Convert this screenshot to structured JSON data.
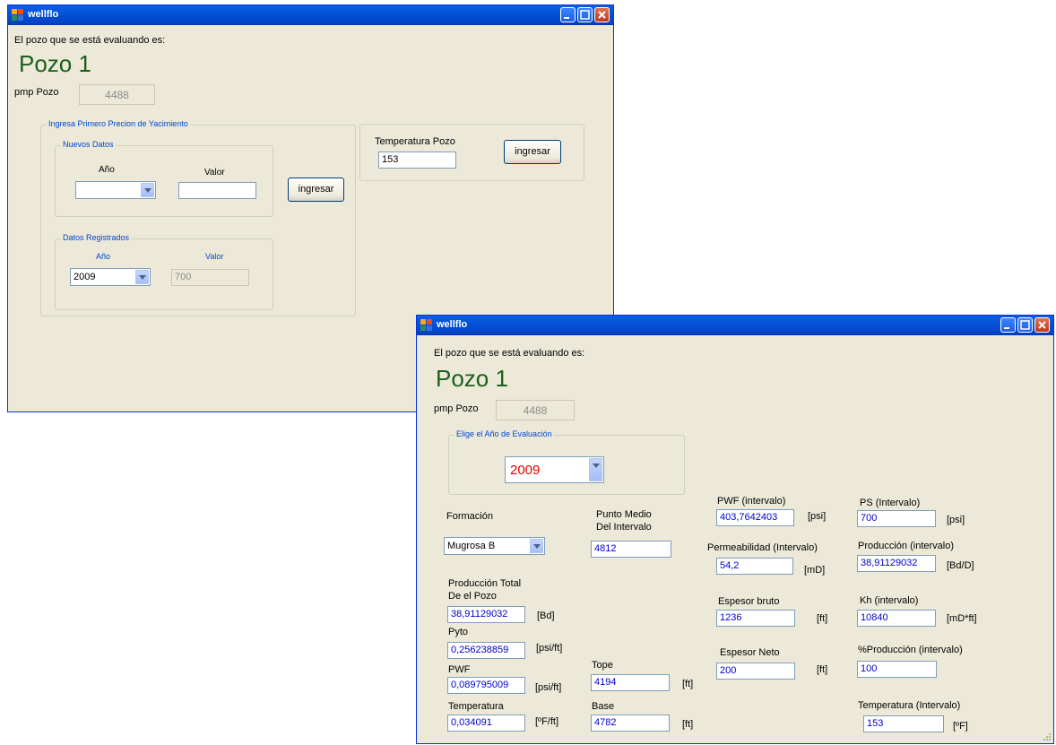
{
  "w1": {
    "title": "wellflo",
    "heading": "El pozo que se está evaluando es:",
    "pozo": "Pozo 1",
    "pmp_label": "pmp Pozo",
    "pmp_value": "4488",
    "grp_outer": "Ingresa Primero Precion de Yacimiento",
    "grp_nuevos": "Nuevos Datos",
    "anio_label": "Año",
    "valor_label": "Valor",
    "ingresar_left": "ingresar",
    "grp_registrados": "Datos Registrados",
    "anio2_label": "Año",
    "valor2_label": "Valor",
    "reg_year": "2009",
    "reg_value": "700",
    "temp_label": "Temperatura Pozo",
    "temp_value": "153",
    "ingresar_right": "ingresar"
  },
  "w2": {
    "title": "wellflo",
    "heading": "El pozo que se está evaluando es:",
    "pozo": "Pozo 1",
    "pmp_label": "pmp Pozo",
    "pmp_value": "4488",
    "grp_year": "Elige el Año de Evaluación",
    "year": "2009",
    "formacion_label": "Formación",
    "formacion_value": "Mugrosa B",
    "punto_medio_l1": "Punto Medio",
    "punto_medio_l2": "Del Intervalo",
    "punto_medio_value": "4812",
    "prod_total_l1": "Producción Total",
    "prod_total_l2": "De el Pozo",
    "prod_total_value": "38,91129032",
    "prod_total_unit": "[Bd]",
    "pyto_label": "Pyto",
    "pyto_value": "0,256238859",
    "pyto_unit": "[psi/ft]",
    "pwf_label": "PWF",
    "pwf_value": "0,089795009",
    "pwf_unit": "[psi/ft]",
    "temperatura_label": "Temperatura",
    "temperatura_value": "0,034091",
    "temperatura_unit": "[ºF/ft]",
    "tope_label": "Tope",
    "tope_value": "4194",
    "tope_unit": "[ft]",
    "base_label": "Base",
    "base_value": "4782",
    "base_unit": "[ft]",
    "pwf_int_label": "PWF (intervalo)",
    "pwf_int_value": "403,7642403",
    "pwf_int_unit": "[psi]",
    "perm_label": "Permeabilidad (Intervalo)",
    "perm_value": "54,2",
    "perm_unit": "[mD]",
    "esp_bruto_label": "Espesor bruto",
    "esp_bruto_value": "1236",
    "esp_bruto_unit": "[ft]",
    "esp_neto_label": "Espesor Neto",
    "esp_neto_value": "200",
    "esp_neto_unit": "[ft]",
    "ps_label": "PS (Intervalo)",
    "ps_value": "700",
    "ps_unit": "[psi]",
    "prod_int_label": "Producción (intervalo)",
    "prod_int_value": "38,91129032",
    "prod_int_unit": "[Bd/D]",
    "kh_label": "Kh (intervalo)",
    "kh_value": "10840",
    "kh_unit": "[mD*ft]",
    "pct_label": "%Producción (intervalo)",
    "pct_value": "100",
    "temp_int_label": "Temperatura (Intervalo)",
    "temp_int_value": "153",
    "temp_int_unit": "[ºF]"
  },
  "colors": {
    "title_bar": "#0552d6",
    "window_bg": "#ece9d8",
    "pozo_text": "#1c5f1c",
    "year_text": "#e00000",
    "value_text": "#0000cc"
  },
  "icons": [
    "app-icon",
    "minimize-icon",
    "maximize-icon",
    "close-icon",
    "dropdown-arrow-icon"
  ]
}
